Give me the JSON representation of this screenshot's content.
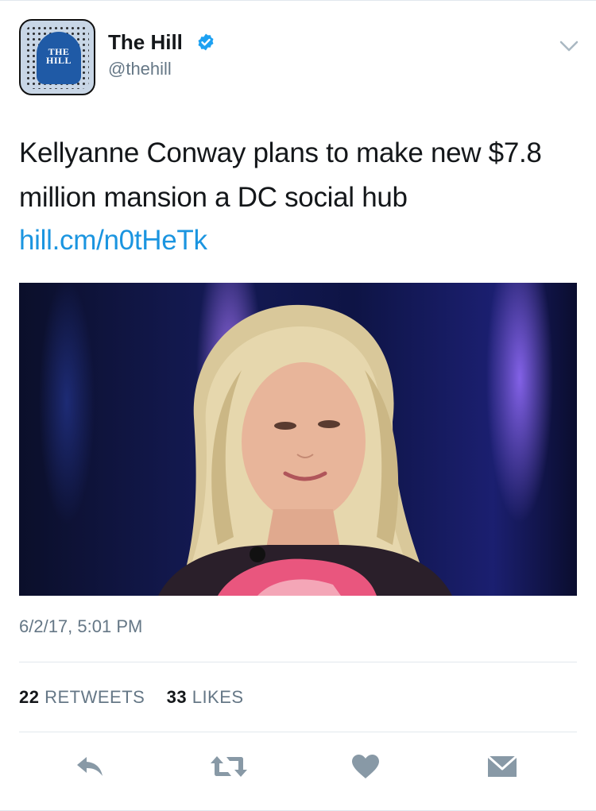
{
  "account": {
    "name": "The Hill",
    "handle": "@thehill",
    "avatar_text_line1": "THE",
    "avatar_text_line2": "HILL",
    "verified": true
  },
  "tweet": {
    "text": "Kellyanne Conway plans to make new $7.8 million mansion a DC social hub",
    "link": "hill.cm/n0tHeTk",
    "timestamp": "6/2/17, 5:01 PM"
  },
  "stats": {
    "retweets_count": "22",
    "retweets_label": "RETWEETS",
    "likes_count": "33",
    "likes_label": "LIKES"
  },
  "colors": {
    "link": "#1b95e0",
    "secondary_text": "#657786",
    "verified_badge": "#1da1f2",
    "action_icons": "#8899a6",
    "divider": "#e1e8ed"
  },
  "icons": {
    "verified": "verified-badge-icon",
    "menu": "chevron-down-icon",
    "reply": "reply-icon",
    "retweet": "retweet-icon",
    "like": "heart-icon",
    "message": "envelope-icon"
  }
}
